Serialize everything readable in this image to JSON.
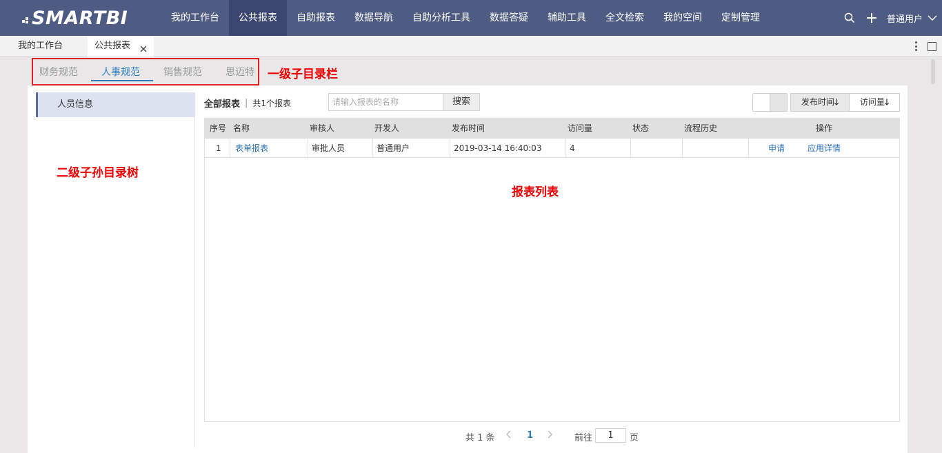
{
  "brand": {
    "logo_text": "SMARTBI"
  },
  "nav": {
    "items": [
      "我的工作台",
      "公共报表",
      "自助报表",
      "数据导航",
      "自助分析工具",
      "数据答疑",
      "辅助工具",
      "全文检索",
      "我的空间",
      "定制管理"
    ],
    "active": "公共报表",
    "user": "普通用户"
  },
  "tabs": [
    {
      "label": "我的工作台"
    },
    {
      "label": "公共报表"
    }
  ],
  "subdir": {
    "items": [
      "财务规范",
      "人事规范",
      "销售规范",
      "思迈特"
    ],
    "active": "人事规范"
  },
  "annotations": {
    "subdir_bar": "一级子目录栏",
    "tree": "二级子孙目录树",
    "list": "报表列表"
  },
  "tree": {
    "items": [
      "人员信息"
    ]
  },
  "list": {
    "title": "全部报表",
    "count": "共1个报表",
    "search_placeholder": "请输入报表的名称",
    "search_button": "搜索",
    "sort_publish": "发布时间",
    "sort_visits": "访问量",
    "columns": [
      "序号",
      "名称",
      "审核人",
      "开发人",
      "发布时间",
      "访问量",
      "状态",
      "流程历史",
      "操作"
    ],
    "rows": [
      {
        "index": "1",
        "name": "表单报表",
        "reviewer": "审批人员",
        "developer": "普通用户",
        "published": "2019-03-14 16:40:03",
        "visits": "4",
        "status": "",
        "history": "",
        "action_apply": "申请",
        "action_detail": "应用详情"
      }
    ]
  },
  "pager": {
    "total": "共 1 条",
    "current": "1",
    "goto_label": "前往",
    "goto_value": "1",
    "page_suffix": "页"
  },
  "colors": {
    "nav_bg": "#4e5c84",
    "nav_active": "#3a4670",
    "accent": "#2a7ec0",
    "annotation": "#e00000"
  }
}
